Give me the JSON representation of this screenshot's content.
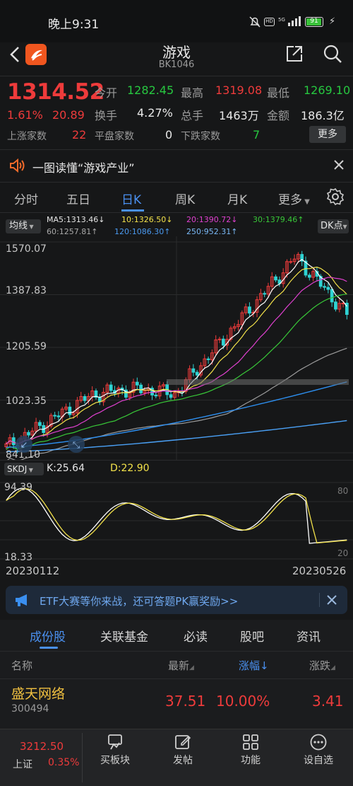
{
  "status_bar": {
    "time": "晚上9:31",
    "battery": "91"
  },
  "header": {
    "title": "游戏",
    "code": "BK1046"
  },
  "quote": {
    "price": "1314.52",
    "pct": "1.61%",
    "change": "20.89",
    "open_label": "今开",
    "open": "1282.45",
    "high_label": "最高",
    "high": "1319.08",
    "low_label": "最低",
    "low": "1269.10",
    "turnover_label": "换手",
    "turnover": "4.27%",
    "volume_label": "总手",
    "volume": "1463万",
    "amount_label": "金额",
    "amount": "186.3亿",
    "up_label": "上涨家数",
    "up": "22",
    "flat_label": "平盘家数",
    "flat": "0",
    "down_label": "下跌家数",
    "down": "7",
    "more": "更多"
  },
  "notice": {
    "text": "一图读懂“游戏产业”"
  },
  "tabs": [
    "分时",
    "五日",
    "日K",
    "周K",
    "月K",
    "更多"
  ],
  "active_tab": 2,
  "ma_legend": {
    "selector": "均线",
    "ma5": "MA5:1313.46↓",
    "ma10": "10:1326.50↓",
    "ma20": "20:1390.72↓",
    "ma30": "30:1379.46↑",
    "ma60": "60:1257.81↑",
    "ma120": "120:1086.30↑",
    "ma250": "250:952.31↑",
    "dk": "DK点"
  },
  "price_axis": [
    "1570.07",
    "1387.83",
    "1205.59",
    "1023.35",
    "841.10"
  ],
  "indicator": {
    "name": "SKDJ",
    "k": "K:25.64",
    "d": "D:22.90",
    "top": "94.39",
    "bottom": "18.33",
    "r80": "80",
    "r20": "20"
  },
  "date_range": {
    "start": "20230112",
    "end": "20230526"
  },
  "colors": {
    "up": "#ee3b3b",
    "down": "#2fd3d3",
    "ma5": "#ffffff",
    "ma10": "#f3e24a",
    "ma20": "#e040d0",
    "ma30": "#38c838",
    "ma60": "#9c9c9c",
    "ma120": "#2d8ff0",
    "ma250": "#4aa0f5"
  },
  "chart_data": {
    "type": "line",
    "title": "",
    "x": [
      "20230112",
      "20230526"
    ],
    "y_ticks": [
      1570.07,
      1387.83,
      1205.59,
      1023.35,
      841.1
    ],
    "ylim": [
      841.1,
      1570.07
    ],
    "series": [
      {
        "name": "MA5",
        "last": 1313.46
      },
      {
        "name": "MA10",
        "last": 1326.5
      },
      {
        "name": "MA20",
        "last": 1390.72
      },
      {
        "name": "MA30",
        "last": 1379.46
      },
      {
        "name": "MA60",
        "last": 1257.81
      },
      {
        "name": "MA120",
        "last": 1086.3
      },
      {
        "name": "MA250",
        "last": 952.31
      }
    ]
  },
  "banner": {
    "text": "ETF大赛等你来战，还可答题PK赢奖励>>"
  },
  "sub_tabs": [
    "成份股",
    "关联基金",
    "必读",
    "股吧",
    "资讯"
  ],
  "table": {
    "headers": {
      "name": "名称",
      "latest": "最新",
      "pct": "涨幅↓",
      "chg": "涨跌"
    },
    "rows": [
      {
        "name": "盛天网络",
        "code": "300494",
        "latest": "37.51",
        "pct": "10.00%",
        "chg": "3.41"
      }
    ]
  },
  "bottom_bar": {
    "index_value": "3212.50",
    "index_name": "上证",
    "index_pct": "0.35%",
    "items": [
      "买板块",
      "发帖",
      "功能",
      "设自选"
    ]
  }
}
